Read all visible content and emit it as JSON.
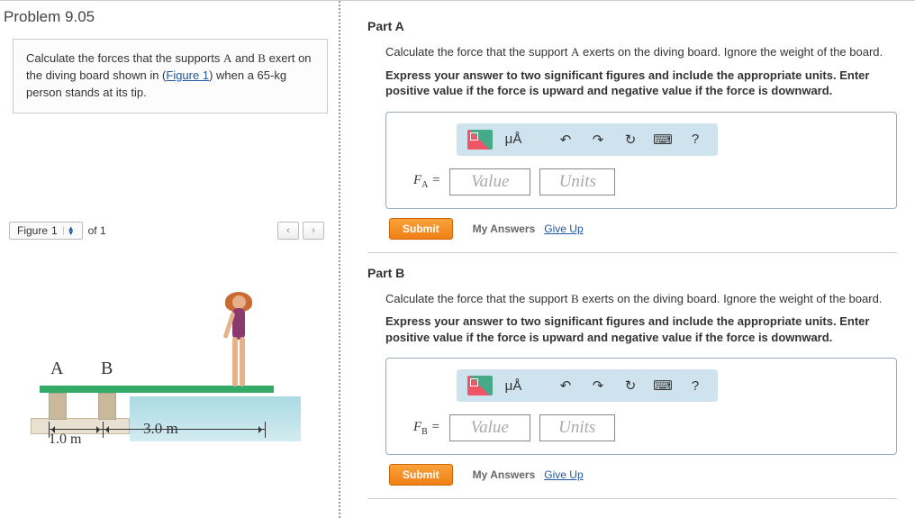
{
  "problem": {
    "title": "Problem 9.05",
    "prompt_pre": "Calculate the forces that the supports ",
    "supportA": "A",
    "prompt_mid1": " and ",
    "supportB": "B",
    "prompt_mid2": " exert on the diving board shown in (",
    "figure_link": "Figure 1",
    "prompt_post": ") when a 65-kg person stands at its tip."
  },
  "figure": {
    "label": "Figure",
    "current": "1",
    "of_text": "of 1",
    "labelA": "A",
    "labelB": "B",
    "dim_ab": "1.0 m",
    "dim_btip": "3.0 m"
  },
  "partA": {
    "heading": "Part A",
    "prompt_pre": "Calculate the force that the support ",
    "support": "A",
    "prompt_post": " exerts on the diving board. Ignore the weight of the board.",
    "instruction": "Express your answer to two significant figures and include the appropriate units. Enter positive value if the force is upward and negative value if the force is downward.",
    "var": "F",
    "sub": "A",
    "eq": " =",
    "value_ph": "Value",
    "units_ph": "Units",
    "submit": "Submit",
    "my_answers": "My Answers",
    "give_up": "Give Up"
  },
  "partB": {
    "heading": "Part B",
    "prompt_pre": "Calculate the force that the support ",
    "support": "B",
    "prompt_post": " exerts on the diving board. Ignore the weight of the board.",
    "instruction": "Express your answer to two significant figures and include the appropriate units. Enter positive value if the force is upward and negative value if the force is downward.",
    "var": "F",
    "sub": "B",
    "eq": " =",
    "value_ph": "Value",
    "units_ph": "Units",
    "submit": "Submit",
    "my_answers": "My Answers",
    "give_up": "Give Up"
  },
  "toolbar": {
    "symbols": "μÅ",
    "help": "?"
  }
}
